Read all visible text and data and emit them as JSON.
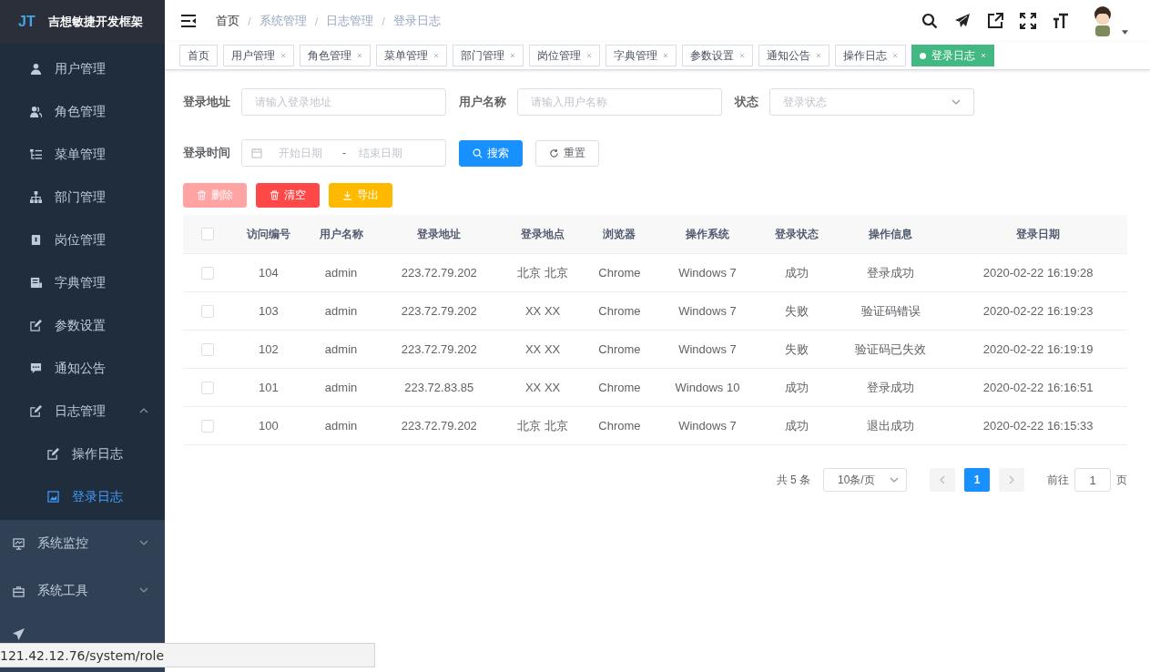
{
  "brand": {
    "logo": "JT",
    "title": "吉想敏捷开发框架"
  },
  "sidebar": {
    "submenu": [
      {
        "label": "用户管理",
        "selected": false
      },
      {
        "label": "角色管理",
        "selected": false
      },
      {
        "label": "菜单管理",
        "selected": false
      },
      {
        "label": "部门管理",
        "selected": false
      },
      {
        "label": "岗位管理",
        "selected": false
      },
      {
        "label": "字典管理",
        "selected": false
      },
      {
        "label": "参数设置",
        "selected": false
      },
      {
        "label": "通知公告",
        "selected": false
      },
      {
        "label": "日志管理",
        "selected": false,
        "expanded": true,
        "children": [
          {
            "label": "操作日志",
            "selected": false
          },
          {
            "label": "登录日志",
            "selected": true
          }
        ]
      }
    ],
    "menu": [
      {
        "label": "系统监控",
        "selected": false,
        "expanded": false
      },
      {
        "label": "系统工具",
        "selected": false,
        "expanded": false
      }
    ]
  },
  "breadcrumb": {
    "separator": "/",
    "items": [
      "首页",
      "系统管理",
      "日志管理",
      "登录日志"
    ]
  },
  "tabs": [
    {
      "label": "首页",
      "selected": false,
      "closable": false
    },
    {
      "label": "用户管理",
      "selected": false,
      "closable": true
    },
    {
      "label": "角色管理",
      "selected": false,
      "closable": true
    },
    {
      "label": "菜单管理",
      "selected": false,
      "closable": true
    },
    {
      "label": "部门管理",
      "selected": false,
      "closable": true
    },
    {
      "label": "岗位管理",
      "selected": false,
      "closable": true
    },
    {
      "label": "字典管理",
      "selected": false,
      "closable": true
    },
    {
      "label": "参数设置",
      "selected": false,
      "closable": true
    },
    {
      "label": "通知公告",
      "selected": false,
      "closable": true
    },
    {
      "label": "操作日志",
      "selected": false,
      "closable": true
    },
    {
      "label": "登录日志",
      "selected": true,
      "closable": true
    }
  ],
  "filters": {
    "address": {
      "label": "登录地址",
      "placeholder": "请输入登录地址"
    },
    "username": {
      "label": "用户名称",
      "placeholder": "请输入用户名称"
    },
    "status": {
      "label": "状态",
      "placeholder": "登录状态"
    },
    "time": {
      "label": "登录时间",
      "start_placeholder": "开始日期",
      "separator": "-",
      "end_placeholder": "结束日期"
    },
    "search_button": "搜索",
    "reset_button": "重置"
  },
  "actions": [
    {
      "kind": "delete",
      "label": "删除",
      "disabled": true
    },
    {
      "kind": "clear",
      "label": "清空",
      "disabled": false
    },
    {
      "kind": "export",
      "label": "导出",
      "disabled": false
    }
  ],
  "table": {
    "all_checked": false,
    "columns": [
      "访问编号",
      "用户名称",
      "登录地址",
      "登录地点",
      "浏览器",
      "操作系统",
      "登录状态",
      "操作信息",
      "登录日期"
    ],
    "rows": [
      {
        "checked": false,
        "cells": [
          "104",
          "admin",
          "223.72.79.202",
          "北京 北京",
          "Chrome",
          "Windows 7",
          "成功",
          "登录成功",
          "2020-02-22 16:19:28"
        ]
      },
      {
        "checked": false,
        "cells": [
          "103",
          "admin",
          "223.72.79.202",
          "XX XX",
          "Chrome",
          "Windows 7",
          "失败",
          "验证码错误",
          "2020-02-22 16:19:23"
        ]
      },
      {
        "checked": false,
        "cells": [
          "102",
          "admin",
          "223.72.79.202",
          "XX XX",
          "Chrome",
          "Windows 7",
          "失败",
          "验证码已失效",
          "2020-02-22 16:19:19"
        ]
      },
      {
        "checked": false,
        "cells": [
          "101",
          "admin",
          "223.72.83.85",
          "XX XX",
          "Chrome",
          "Windows 10",
          "成功",
          "登录成功",
          "2020-02-22 16:16:51"
        ]
      },
      {
        "checked": false,
        "cells": [
          "100",
          "admin",
          "223.72.79.202",
          "北京 北京",
          "Chrome",
          "Windows 7",
          "成功",
          "退出成功",
          "2020-02-22 16:15:33"
        ]
      }
    ]
  },
  "pagination": {
    "total": "共 5 条",
    "page_size": "10条/页",
    "pages": [
      {
        "label": "1",
        "selected": true
      }
    ],
    "goto_label": "前往",
    "goto_value": "1",
    "page_suffix": "页"
  },
  "status_url": "121.42.12.76/system/role"
}
